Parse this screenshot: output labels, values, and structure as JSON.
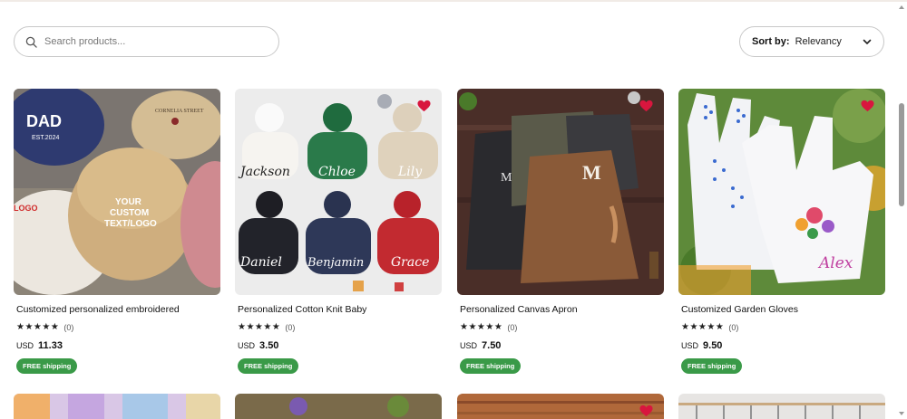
{
  "search": {
    "placeholder": "Search products...",
    "icon": "search-icon"
  },
  "sort": {
    "label": "Sort by:",
    "value": "Relevancy"
  },
  "colors": {
    "free_shipping": "#3a9a48",
    "heart": "#d8163e"
  },
  "products": [
    {
      "title": "Customized personalized embroidered",
      "stars": "★★★★★",
      "count": "(0)",
      "currency": "USD",
      "price": "11.33",
      "shipping": "FREE shipping",
      "favorited": false,
      "image_text": [
        "DAD",
        "EST.2024",
        "CORNELIA STREET",
        "YOUR",
        "CUSTOM",
        "TEXT/LOGO",
        "LOGO"
      ]
    },
    {
      "title": "Personalized Cotton Knit Baby",
      "stars": "★★★★★",
      "count": "(0)",
      "currency": "USD",
      "price": "3.50",
      "shipping": "FREE shipping",
      "favorited": true,
      "image_text": [
        "Jackson",
        "Chloe",
        "Lily",
        "Daniel",
        "Benjamin",
        "Grace"
      ]
    },
    {
      "title": "Personalized Canvas Apron",
      "stars": "★★★★★",
      "count": "(0)",
      "currency": "USD",
      "price": "7.50",
      "shipping": "FREE shipping",
      "favorited": true,
      "image_text": [
        "M|R",
        "M"
      ]
    },
    {
      "title": "Customized Garden Gloves",
      "stars": "★★★★★",
      "count": "(0)",
      "currency": "USD",
      "price": "9.50",
      "shipping": "FREE shipping",
      "favorited": true,
      "image_text": [
        "Alex"
      ]
    }
  ]
}
